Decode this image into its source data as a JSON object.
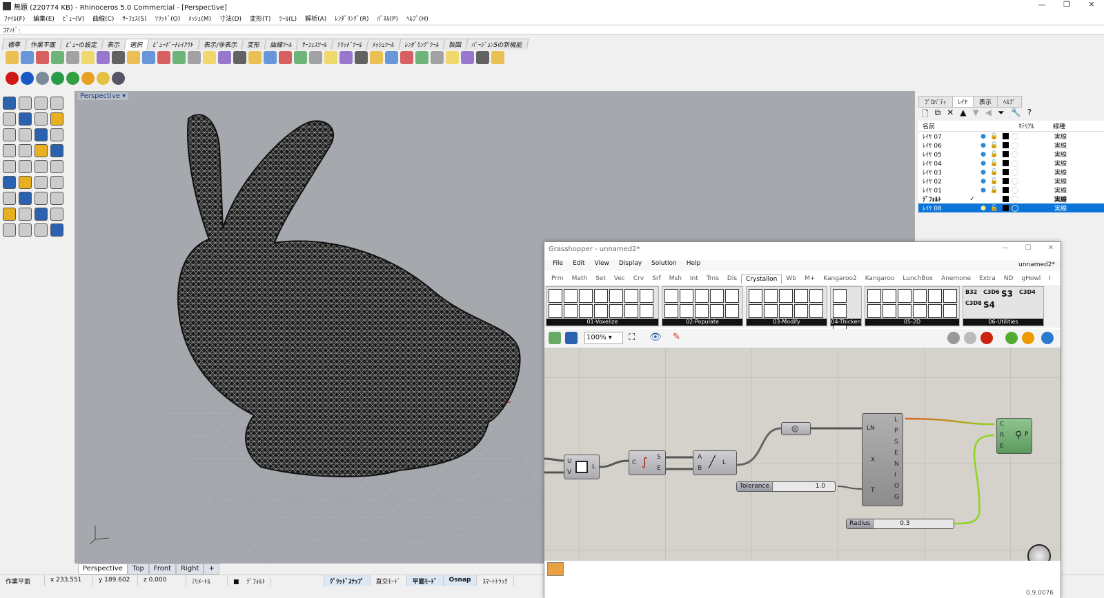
{
  "window": {
    "title": "無題 (220774 KB) - Rhinoceros 5.0 Commercial - [Perspective]"
  },
  "menu": [
    "ﾌｧｲﾙ(F)",
    "編集(E)",
    "ﾋﾞｭｰ(V)",
    "曲線(C)",
    "ｻｰﾌｪｽ(S)",
    "ｿﾘｯﾄﾞ(O)",
    "ﾒｯｼｭ(M)",
    "寸法(D)",
    "変形(T)",
    "ﾂｰﾙ(L)",
    "解析(A)",
    "ﾚﾝﾀﾞﾘﾝｸﾞ(R)",
    "ﾊﾟﾈﾙ(P)",
    "ﾍﾙﾌﾟ(H)"
  ],
  "command": {
    "label": "ｺﾏﾝﾄﾞ:"
  },
  "toolbar_tabs": [
    "標準",
    "作業平面",
    "ﾋﾞｭｰの設定",
    "表示",
    "選択",
    "ﾋﾞｭｰﾎﾟｰﾄﾚｲｱｳﾄ",
    "表示/非表示",
    "変形",
    "曲線ﾂｰﾙ",
    "ｻｰﾌｪｽﾂｰﾙ",
    "ｿﾘｯﾄﾞﾂｰﾙ",
    "ﾒｯｼｭﾂｰﾙ",
    "ﾚﾝﾀﾞﾘﾝｸﾞﾂｰﾙ",
    "製図",
    "ﾊﾞｰｼﾞｮﾝ5の新機能"
  ],
  "viewport": {
    "label": "Perspective",
    "tabs": [
      "Perspective",
      "Top",
      "Front",
      "Right",
      "+"
    ]
  },
  "status": {
    "cplane": "作業平面",
    "x": "x 233.551",
    "y": "y 189.602",
    "z": "z 0.000",
    "units": "ﾐﾘﾒｰﾄﾙ",
    "layer": "ﾃﾞﾌｫﾙﾄ",
    "grid_snap": "ｸﾞﾘｯﾄﾞｽﾅｯﾌﾟ",
    "ortho": "直交ﾓｰﾄﾞ",
    "planar": "平面ﾓｰﾄﾞ",
    "osnap": "Osnap",
    "smarttrack": "ｽﾏｰﾄﾄﾗｯｸ"
  },
  "panel": {
    "tabs": [
      "ﾌﾟﾛﾊﾟﾃｨ",
      "ﾚｲﾔ",
      "表示",
      "ﾍﾙﾌﾟ"
    ],
    "headers": {
      "name": "名前",
      "material": "ﾏﾃﾘｱﾙ",
      "linetype": "線種"
    },
    "layers": [
      {
        "name": "ﾚｲﾔ 07",
        "check": "",
        "linetype": "実線"
      },
      {
        "name": "ﾚｲﾔ 06",
        "check": "",
        "linetype": "実線"
      },
      {
        "name": "ﾚｲﾔ 05",
        "check": "",
        "linetype": "実線"
      },
      {
        "name": "ﾚｲﾔ 04",
        "check": "",
        "linetype": "実線"
      },
      {
        "name": "ﾚｲﾔ 03",
        "check": "",
        "linetype": "実線"
      },
      {
        "name": "ﾚｲﾔ 02",
        "check": "",
        "linetype": "実線"
      },
      {
        "name": "ﾚｲﾔ 01",
        "check": "",
        "linetype": "実線"
      },
      {
        "name": "ﾃﾞﾌｫﾙﾄ",
        "check": "✓",
        "linetype": "実線"
      },
      {
        "name": "ﾚｲﾔ 08",
        "check": "",
        "linetype": "実線"
      }
    ]
  },
  "gh": {
    "title": "Grasshopper - unnamed2*",
    "doc": "unnamed2*",
    "menu": [
      "File",
      "Edit",
      "View",
      "Display",
      "Solution",
      "Help"
    ],
    "tabs": [
      "Prm",
      "Math",
      "Set",
      "Vec",
      "Crv",
      "Srf",
      "Msh",
      "Int",
      "Trns",
      "Dis",
      "Crystallon",
      "Wb",
      "M+",
      "Kangaroo2",
      "Kangaroo",
      "LunchBox",
      "Anemone",
      "Extra",
      "ND",
      "gHowl",
      "I"
    ],
    "groups": [
      "01-Voxelize",
      "02-Populate",
      "03-Modify",
      "04-Thicken",
      "05-2D",
      "06-Utilities"
    ],
    "util_labels": [
      "B32",
      "C3D6",
      "S3",
      "C3D4",
      "C3D8",
      "S4"
    ],
    "zoom": "100%",
    "components": {
      "u": "U",
      "v": "V",
      "l": "L",
      "c": "C",
      "s": "S",
      "e": "E",
      "a": "A",
      "b": "B",
      "ln": "LN",
      "x": "X",
      "t": "T",
      "outs": [
        "L",
        "P",
        "S",
        "E",
        "N",
        "I",
        "O",
        "G"
      ],
      "pipe_in": [
        "C",
        "R",
        "E"
      ],
      "pipe_out": "P"
    },
    "sliders": {
      "tolerance": {
        "label": "Tolerance",
        "value": "1.0"
      },
      "radius": {
        "label": "Radius",
        "value": "0.3"
      }
    },
    "version": "0.9.0076"
  }
}
